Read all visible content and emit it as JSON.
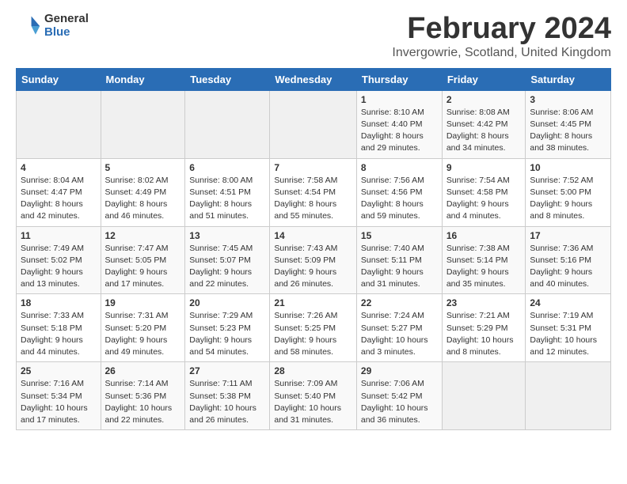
{
  "header": {
    "logo_general": "General",
    "logo_blue": "Blue",
    "month_title": "February 2024",
    "location": "Invergowrie, Scotland, United Kingdom"
  },
  "weekdays": [
    "Sunday",
    "Monday",
    "Tuesday",
    "Wednesday",
    "Thursday",
    "Friday",
    "Saturday"
  ],
  "weeks": [
    [
      {
        "day": "",
        "info": ""
      },
      {
        "day": "",
        "info": ""
      },
      {
        "day": "",
        "info": ""
      },
      {
        "day": "",
        "info": ""
      },
      {
        "day": "1",
        "info": "Sunrise: 8:10 AM\nSunset: 4:40 PM\nDaylight: 8 hours\nand 29 minutes."
      },
      {
        "day": "2",
        "info": "Sunrise: 8:08 AM\nSunset: 4:42 PM\nDaylight: 8 hours\nand 34 minutes."
      },
      {
        "day": "3",
        "info": "Sunrise: 8:06 AM\nSunset: 4:45 PM\nDaylight: 8 hours\nand 38 minutes."
      }
    ],
    [
      {
        "day": "4",
        "info": "Sunrise: 8:04 AM\nSunset: 4:47 PM\nDaylight: 8 hours\nand 42 minutes."
      },
      {
        "day": "5",
        "info": "Sunrise: 8:02 AM\nSunset: 4:49 PM\nDaylight: 8 hours\nand 46 minutes."
      },
      {
        "day": "6",
        "info": "Sunrise: 8:00 AM\nSunset: 4:51 PM\nDaylight: 8 hours\nand 51 minutes."
      },
      {
        "day": "7",
        "info": "Sunrise: 7:58 AM\nSunset: 4:54 PM\nDaylight: 8 hours\nand 55 minutes."
      },
      {
        "day": "8",
        "info": "Sunrise: 7:56 AM\nSunset: 4:56 PM\nDaylight: 8 hours\nand 59 minutes."
      },
      {
        "day": "9",
        "info": "Sunrise: 7:54 AM\nSunset: 4:58 PM\nDaylight: 9 hours\nand 4 minutes."
      },
      {
        "day": "10",
        "info": "Sunrise: 7:52 AM\nSunset: 5:00 PM\nDaylight: 9 hours\nand 8 minutes."
      }
    ],
    [
      {
        "day": "11",
        "info": "Sunrise: 7:49 AM\nSunset: 5:02 PM\nDaylight: 9 hours\nand 13 minutes."
      },
      {
        "day": "12",
        "info": "Sunrise: 7:47 AM\nSunset: 5:05 PM\nDaylight: 9 hours\nand 17 minutes."
      },
      {
        "day": "13",
        "info": "Sunrise: 7:45 AM\nSunset: 5:07 PM\nDaylight: 9 hours\nand 22 minutes."
      },
      {
        "day": "14",
        "info": "Sunrise: 7:43 AM\nSunset: 5:09 PM\nDaylight: 9 hours\nand 26 minutes."
      },
      {
        "day": "15",
        "info": "Sunrise: 7:40 AM\nSunset: 5:11 PM\nDaylight: 9 hours\nand 31 minutes."
      },
      {
        "day": "16",
        "info": "Sunrise: 7:38 AM\nSunset: 5:14 PM\nDaylight: 9 hours\nand 35 minutes."
      },
      {
        "day": "17",
        "info": "Sunrise: 7:36 AM\nSunset: 5:16 PM\nDaylight: 9 hours\nand 40 minutes."
      }
    ],
    [
      {
        "day": "18",
        "info": "Sunrise: 7:33 AM\nSunset: 5:18 PM\nDaylight: 9 hours\nand 44 minutes."
      },
      {
        "day": "19",
        "info": "Sunrise: 7:31 AM\nSunset: 5:20 PM\nDaylight: 9 hours\nand 49 minutes."
      },
      {
        "day": "20",
        "info": "Sunrise: 7:29 AM\nSunset: 5:23 PM\nDaylight: 9 hours\nand 54 minutes."
      },
      {
        "day": "21",
        "info": "Sunrise: 7:26 AM\nSunset: 5:25 PM\nDaylight: 9 hours\nand 58 minutes."
      },
      {
        "day": "22",
        "info": "Sunrise: 7:24 AM\nSunset: 5:27 PM\nDaylight: 10 hours\nand 3 minutes."
      },
      {
        "day": "23",
        "info": "Sunrise: 7:21 AM\nSunset: 5:29 PM\nDaylight: 10 hours\nand 8 minutes."
      },
      {
        "day": "24",
        "info": "Sunrise: 7:19 AM\nSunset: 5:31 PM\nDaylight: 10 hours\nand 12 minutes."
      }
    ],
    [
      {
        "day": "25",
        "info": "Sunrise: 7:16 AM\nSunset: 5:34 PM\nDaylight: 10 hours\nand 17 minutes."
      },
      {
        "day": "26",
        "info": "Sunrise: 7:14 AM\nSunset: 5:36 PM\nDaylight: 10 hours\nand 22 minutes."
      },
      {
        "day": "27",
        "info": "Sunrise: 7:11 AM\nSunset: 5:38 PM\nDaylight: 10 hours\nand 26 minutes."
      },
      {
        "day": "28",
        "info": "Sunrise: 7:09 AM\nSunset: 5:40 PM\nDaylight: 10 hours\nand 31 minutes."
      },
      {
        "day": "29",
        "info": "Sunrise: 7:06 AM\nSunset: 5:42 PM\nDaylight: 10 hours\nand 36 minutes."
      },
      {
        "day": "",
        "info": ""
      },
      {
        "day": "",
        "info": ""
      }
    ]
  ]
}
